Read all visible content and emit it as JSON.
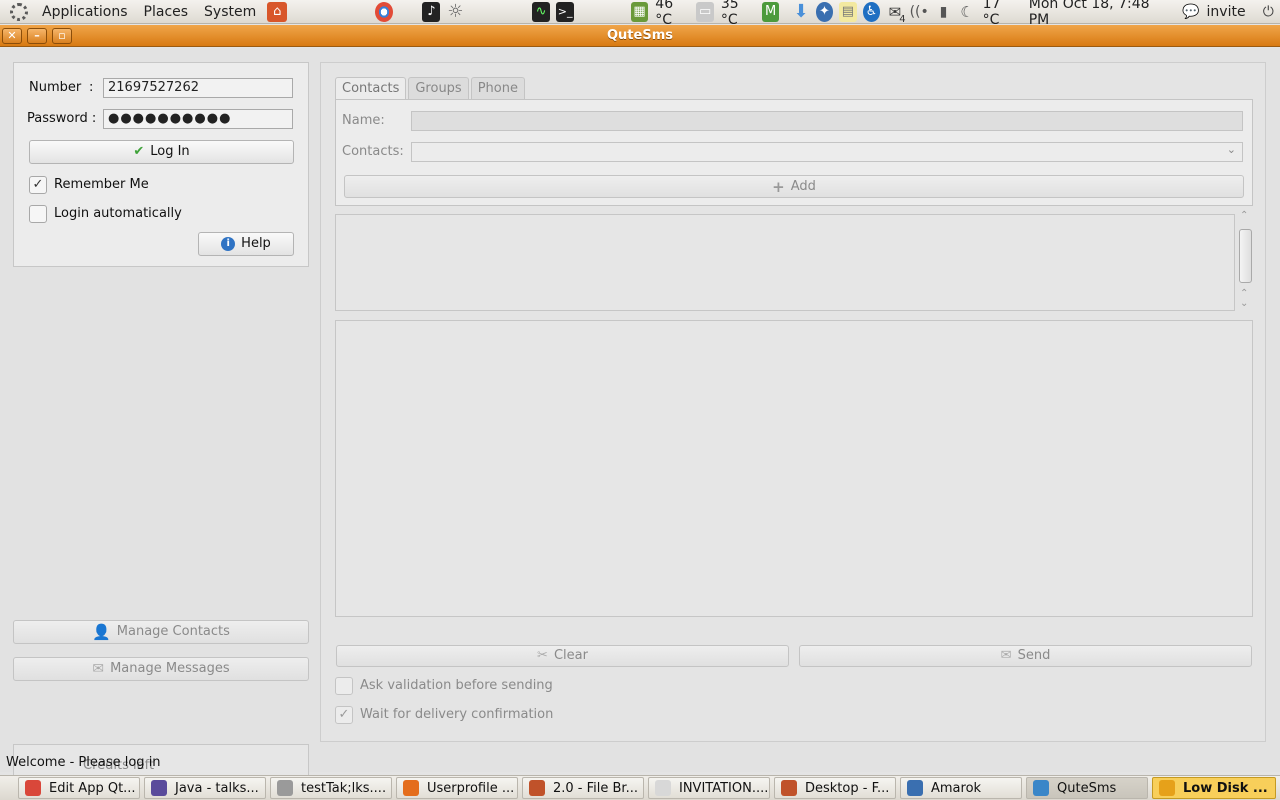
{
  "top_panel": {
    "menus": [
      "Applications",
      "Places",
      "System"
    ],
    "cpu_temp": "46 °C",
    "disk_temp": "35 °C",
    "weather": "17 °C",
    "mail_count": "4",
    "clock": "Mon Oct 18,  7:48 PM",
    "user": "invite"
  },
  "window": {
    "title": "QuteSms"
  },
  "login": {
    "number_label": "Number",
    "number_colon": ":",
    "number_value": "21697527262",
    "password_label": "Password :",
    "password_value": "●●●●●●●●●●",
    "login_button": "Log In",
    "remember_me": "Remember Me",
    "remember_checked": "✓",
    "login_auto": "Login automatically",
    "help_button": "Help"
  },
  "left_actions": {
    "manage_contacts": "Manage Contacts",
    "manage_messages": "Manage Messages",
    "credits": "Credits left"
  },
  "tabs": [
    {
      "label": "Contacts"
    },
    {
      "label": "Groups"
    },
    {
      "label": "Phone"
    }
  ],
  "contacts_tab": {
    "name_label": "Name:",
    "contacts_label": "Contacts:",
    "add_button": "Add"
  },
  "actions": {
    "clear": "Clear",
    "send": "Send",
    "ask_validation": "Ask validation before sending",
    "wait_delivery": "Wait for delivery confirmation",
    "wait_checked": "✓"
  },
  "status": "Welcome - Please log in",
  "taskbar": [
    {
      "label": "Edit App Qt...",
      "color": "#d9473a"
    },
    {
      "label": "Java - talks...",
      "color": "#5a4b9b"
    },
    {
      "label": "testTak;lks....",
      "color": "#9a9a9a"
    },
    {
      "label": "Userprofile ...",
      "color": "#e46d1c"
    },
    {
      "label": "2.0 - File Br...",
      "color": "#c0522a"
    },
    {
      "label": "INVITATION....",
      "color": "#d8d8d8"
    },
    {
      "label": "Desktop - F...",
      "color": "#c0522a"
    },
    {
      "label": "Amarok",
      "color": "#3a6fb0"
    },
    {
      "label": "QuteSms",
      "color": "#3a86c8"
    },
    {
      "label": "Low Disk ...",
      "color": "#e6a11a"
    }
  ]
}
